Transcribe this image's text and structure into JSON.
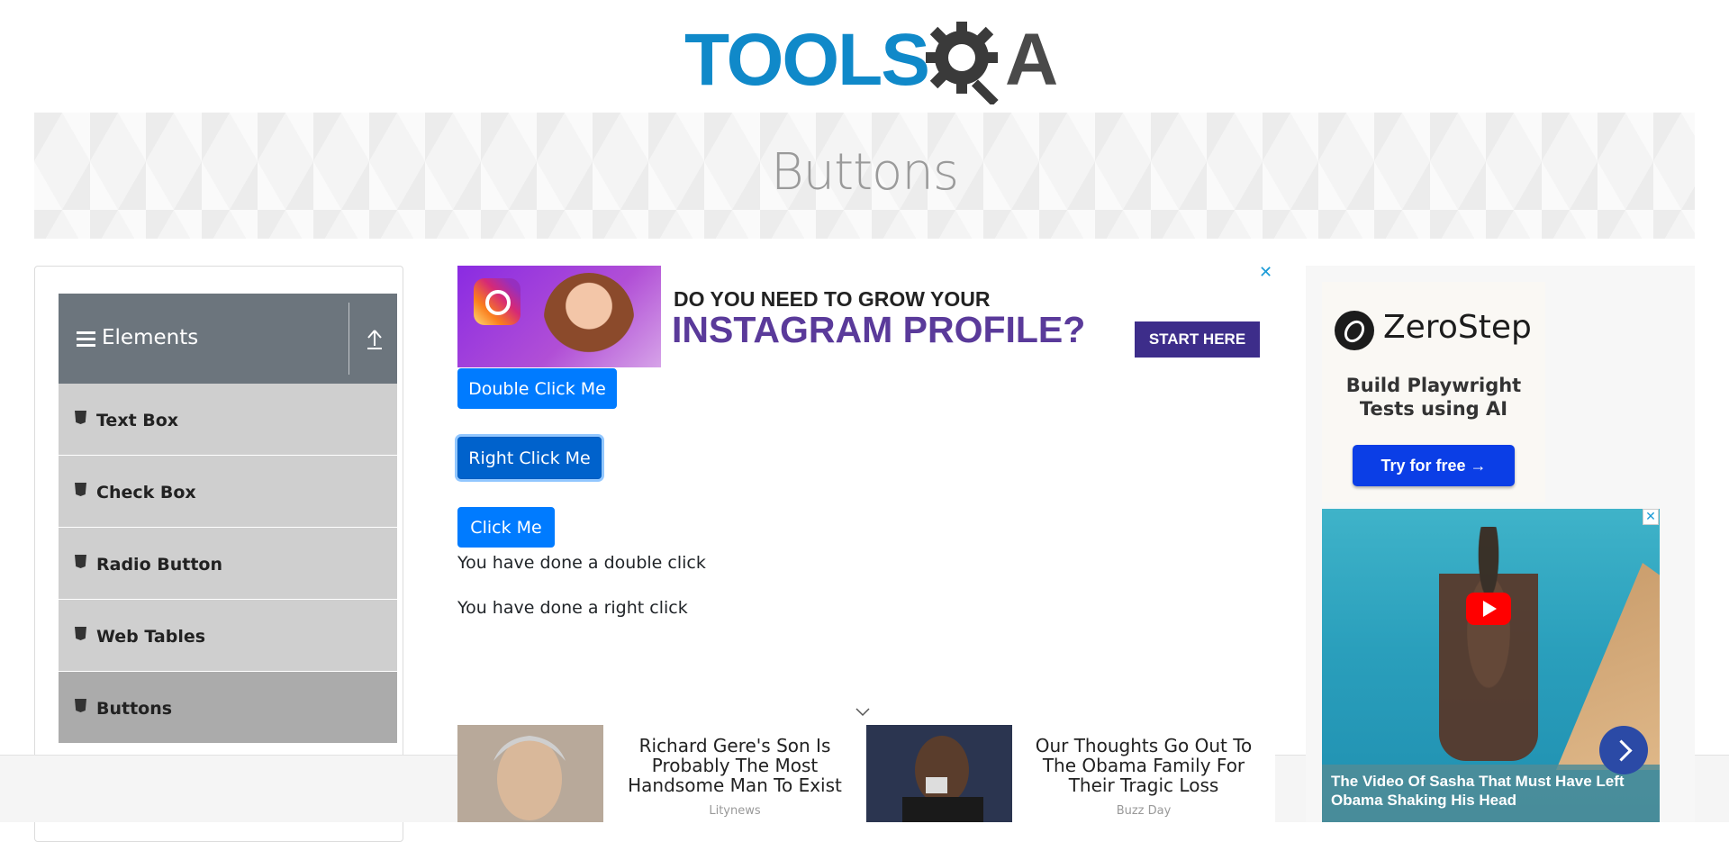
{
  "header": {
    "logo_text": "TOOLS",
    "logo_suffix": "A"
  },
  "banner": {
    "title": "Buttons"
  },
  "sidebar": {
    "group_title": "Elements",
    "items": [
      {
        "label": "Text Box"
      },
      {
        "label": "Check Box"
      },
      {
        "label": "Radio Button"
      },
      {
        "label": "Web Tables"
      },
      {
        "label": "Buttons"
      }
    ],
    "active_item": "Buttons"
  },
  "top_ad": {
    "line1": "DO YOU NEED TO GROW YOUR",
    "line2": "INSTAGRAM PROFILE?",
    "cta": "START HERE",
    "close": "✕"
  },
  "buttons": {
    "double_click": "Double Click Me",
    "right_click": "Right Click Me",
    "click": "Click Me"
  },
  "messages": {
    "double_click": "You have done a double click",
    "right_click": "You have done a right click"
  },
  "bottom_ads": [
    {
      "headline": "Richard Gere's Son Is Probably The Most Handsome Man To Exist",
      "source": "Litynews"
    },
    {
      "headline": "Our Thoughts Go Out To The Obama Family For Their Tragic Loss",
      "source": "Buzz Day"
    }
  ],
  "right_ads": {
    "zerostep": {
      "name": "ZeroStep",
      "tagline": "Build Playwright Tests using AI",
      "cta": "Try for free →"
    },
    "video": {
      "caption": "The Video Of Sasha That Must Have Left Obama Shaking His Head",
      "close": "✕"
    }
  },
  "colors": {
    "primary": "#007bff",
    "logo_blue": "#1089c9",
    "sidebar_header": "#6c757d",
    "sidebar_item": "#cfcfcf",
    "sidebar_active": "#ababab"
  }
}
